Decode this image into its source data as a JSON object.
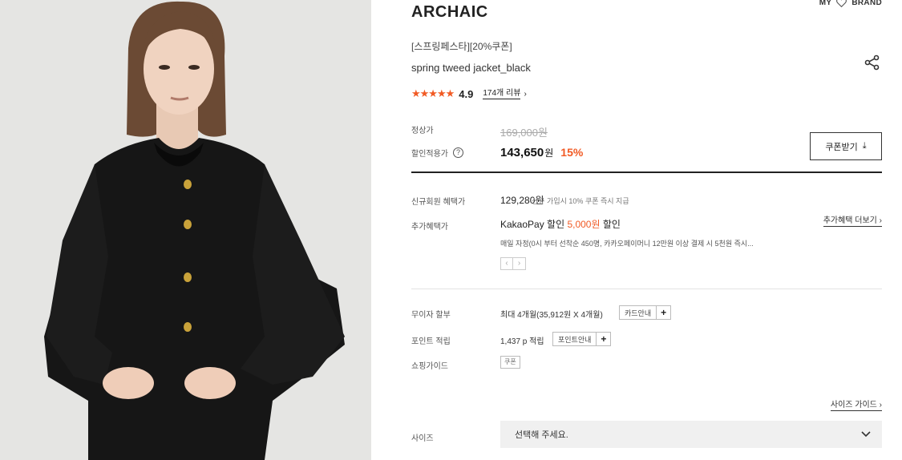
{
  "header": {
    "my_label": "MY",
    "brand_label": "BRAND"
  },
  "product": {
    "brand": "ARCHAIC",
    "tag_line": "[스프링페스타][20%쿠폰]",
    "name": "spring tweed jacket_black"
  },
  "rating": {
    "stars": "★★★★★",
    "score": "4.9",
    "review_count": "174개 리뷰",
    "review_chevron": "›"
  },
  "pricing": {
    "regular_label": "정상가",
    "regular_price": "169,000원",
    "sale_label": "할인적용가",
    "sale_help": "?",
    "sale_price": "143,650",
    "sale_won": "원",
    "discount": "15%",
    "coupon_button": "쿠폰받기",
    "coupon_icon": "⤓"
  },
  "benefits": {
    "new_member_label": "신규회원 혜택가",
    "new_member_price": "129,280원",
    "new_member_note": "신규 가입시 10% 쿠폰 즉시 지급",
    "extra_label": "추가혜택가",
    "extra_prefix": "KakaoPay 할인 ",
    "extra_amount": "5,000원",
    "extra_suffix": " 할인",
    "extra_more": "추가혜택 더보기 ›",
    "extra_desc": "매일 자정(0시 부터 선착순 450명, 카카오페이머니 12만원 이상 결제 시 5천원 즉시...",
    "pager_prev": "‹",
    "pager_next": "›"
  },
  "payment": {
    "installment_label": "무이자 할부",
    "installment_text": "최대 4개월(35,912원 X 4개월)",
    "card_guide_button": "카드안내",
    "point_label": "포인트 적립",
    "point_text": "1,437 p 적립",
    "point_guide_button": "포인트안내",
    "plus": "+",
    "shopping_guide_label": "쇼핑가이드",
    "shopping_guide_coupon": "쿠폰"
  },
  "size": {
    "guide_link": "사이즈 가이드 ›",
    "label": "사이즈",
    "placeholder": "선택해 주세요."
  },
  "colors": {
    "accent": "#f15a24",
    "text": "#222222",
    "select_bg": "#f0f0f0"
  },
  "icons": {
    "wishlist": "heart-icon",
    "share": "share-icon",
    "dropdown": "chevron-down-icon"
  }
}
